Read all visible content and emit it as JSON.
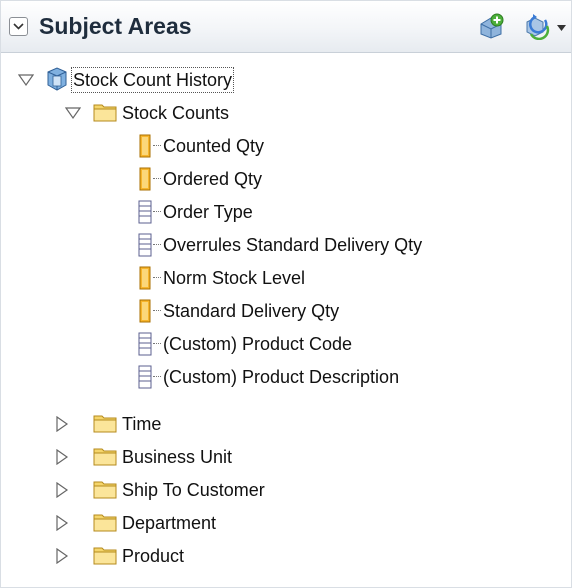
{
  "header": {
    "title": "Subject Areas"
  },
  "tree": {
    "root": {
      "label": "Stock Count History",
      "expanded": true
    },
    "stock_counts": {
      "label": "Stock Counts",
      "expanded": true,
      "items": [
        {
          "label": "Counted Qty",
          "kind": "measure"
        },
        {
          "label": "Ordered Qty",
          "kind": "measure"
        },
        {
          "label": "Order Type",
          "kind": "attribute"
        },
        {
          "label": "Overrules Standard Delivery Qty",
          "kind": "attribute"
        },
        {
          "label": "Norm Stock Level",
          "kind": "measure"
        },
        {
          "label": "Standard Delivery Qty",
          "kind": "measure"
        },
        {
          "label": "(Custom) Product Code",
          "kind": "attribute"
        },
        {
          "label": "(Custom) Product Description",
          "kind": "attribute"
        }
      ]
    },
    "folders": [
      {
        "label": "Time",
        "expanded": false
      },
      {
        "label": "Business Unit",
        "expanded": false
      },
      {
        "label": "Ship To Customer",
        "expanded": false
      },
      {
        "label": "Department",
        "expanded": false
      },
      {
        "label": "Product",
        "expanded": false
      }
    ]
  }
}
